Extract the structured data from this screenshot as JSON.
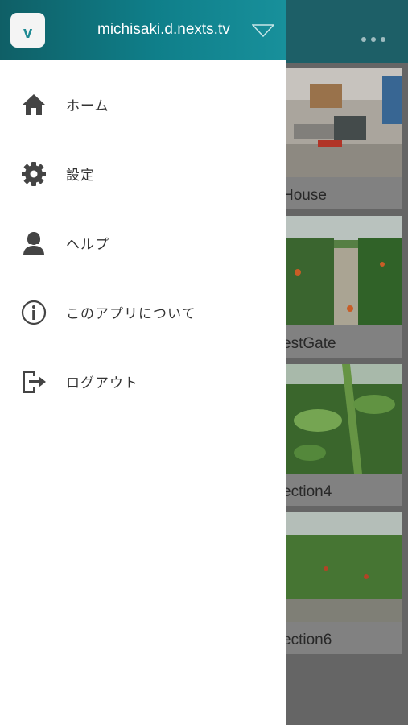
{
  "header": {
    "logo_text": "v",
    "account_name": "michisaki.d.nexts.tv",
    "dropdown_icon": "triangle-down-icon",
    "more_icon": "ellipsis-icon"
  },
  "menu": {
    "items": [
      {
        "label": "ホーム",
        "icon": "home-icon"
      },
      {
        "label": "設定",
        "icon": "gear-icon"
      },
      {
        "label": "ヘルプ",
        "icon": "person-icon"
      },
      {
        "label": "このアプリについて",
        "icon": "info-icon"
      },
      {
        "label": "ログアウト",
        "icon": "logout-icon"
      }
    ]
  },
  "background_cards": [
    {
      "label": "House"
    },
    {
      "label": "estGate"
    },
    {
      "label": "ection4"
    },
    {
      "label": "ection6"
    }
  ],
  "colors": {
    "header_accent": "#0f7f8a",
    "drawer_background": "#ffffff",
    "icon_color": "#444444"
  }
}
